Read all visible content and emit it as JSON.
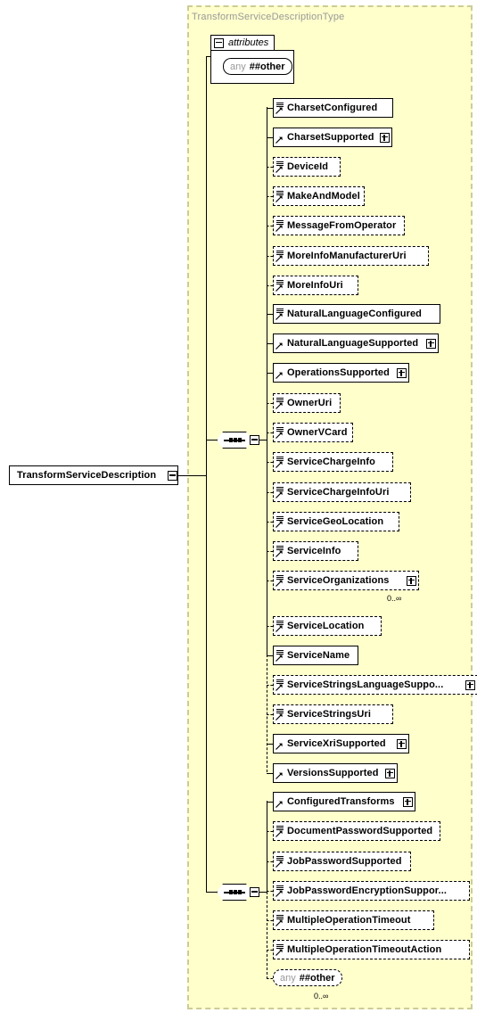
{
  "diagram": {
    "kind": "xml-schema-element-diagram",
    "type_container_label": "TransformServiceDescriptionType",
    "root": {
      "label": "TransformServiceDescription",
      "toggle": "minus"
    },
    "attributes_group": {
      "label": "attributes",
      "toggle": "minus",
      "wildcard": {
        "any": "any",
        "namespace": "##other"
      }
    },
    "sequences": [
      {
        "name": "sequence-1",
        "compositor_icon": "sequence-icon",
        "toggle": "minus",
        "children": [
          {
            "label": "CharsetConfigured",
            "optional": false,
            "icon": true,
            "expand": false,
            "cardinality": ""
          },
          {
            "label": "CharsetSupported",
            "optional": false,
            "icon": false,
            "expand": true,
            "cardinality": ""
          },
          {
            "label": "DeviceId",
            "optional": true,
            "icon": true,
            "expand": false,
            "cardinality": ""
          },
          {
            "label": "MakeAndModel",
            "optional": true,
            "icon": true,
            "expand": false,
            "cardinality": ""
          },
          {
            "label": "MessageFromOperator",
            "optional": true,
            "icon": true,
            "expand": false,
            "cardinality": ""
          },
          {
            "label": "MoreInfoManufacturerUri",
            "optional": true,
            "icon": true,
            "expand": false,
            "cardinality": ""
          },
          {
            "label": "MoreInfoUri",
            "optional": true,
            "icon": true,
            "expand": false,
            "cardinality": ""
          },
          {
            "label": "NaturalLanguageConfigured",
            "optional": false,
            "icon": true,
            "expand": false,
            "cardinality": ""
          },
          {
            "label": "NaturalLanguageSupported",
            "optional": false,
            "icon": false,
            "expand": true,
            "cardinality": ""
          },
          {
            "label": "OperationsSupported",
            "optional": false,
            "icon": false,
            "expand": true,
            "cardinality": ""
          },
          {
            "label": "OwnerUri",
            "optional": true,
            "icon": true,
            "expand": false,
            "cardinality": ""
          },
          {
            "label": "OwnerVCard",
            "optional": true,
            "icon": true,
            "expand": false,
            "cardinality": ""
          },
          {
            "label": "ServiceChargeInfo",
            "optional": true,
            "icon": true,
            "expand": false,
            "cardinality": ""
          },
          {
            "label": "ServiceChargeInfoUri",
            "optional": true,
            "icon": true,
            "expand": false,
            "cardinality": ""
          },
          {
            "label": "ServiceGeoLocation",
            "optional": true,
            "icon": true,
            "expand": false,
            "cardinality": ""
          },
          {
            "label": "ServiceInfo",
            "optional": true,
            "icon": true,
            "expand": false,
            "cardinality": ""
          },
          {
            "label": "ServiceOrganizations",
            "optional": true,
            "icon": true,
            "expand": true,
            "cardinality": "0..∞"
          },
          {
            "label": "ServiceLocation",
            "optional": true,
            "icon": true,
            "expand": false,
            "cardinality": ""
          },
          {
            "label": "ServiceName",
            "optional": false,
            "icon": true,
            "expand": false,
            "cardinality": ""
          },
          {
            "label": "ServiceStringsLanguageSuppo...",
            "optional": true,
            "icon": true,
            "expand": true,
            "cardinality": ""
          },
          {
            "label": "ServiceStringsUri",
            "optional": true,
            "icon": true,
            "expand": false,
            "cardinality": ""
          },
          {
            "label": "ServiceXriSupported",
            "optional": false,
            "icon": false,
            "expand": true,
            "cardinality": ""
          },
          {
            "label": "VersionsSupported",
            "optional": false,
            "icon": false,
            "expand": true,
            "cardinality": ""
          }
        ]
      },
      {
        "name": "sequence-2",
        "compositor_icon": "sequence-icon",
        "toggle": "minus",
        "children": [
          {
            "label": "ConfiguredTransforms",
            "optional": false,
            "icon": false,
            "expand": true,
            "cardinality": ""
          },
          {
            "label": "DocumentPasswordSupported",
            "optional": true,
            "icon": true,
            "expand": false,
            "cardinality": ""
          },
          {
            "label": "JobPasswordSupported",
            "optional": true,
            "icon": true,
            "expand": false,
            "cardinality": ""
          },
          {
            "label": "JobPasswordEncryptionSuppor...",
            "optional": true,
            "icon": true,
            "expand": false,
            "cardinality": ""
          },
          {
            "label": "MultipleOperationTimeout",
            "optional": true,
            "icon": true,
            "expand": false,
            "cardinality": ""
          },
          {
            "label": "MultipleOperationTimeoutAction",
            "optional": true,
            "icon": true,
            "expand": false,
            "cardinality": ""
          }
        ],
        "wildcard": {
          "any": "any",
          "namespace": "##other",
          "cardinality": "0..∞"
        }
      }
    ],
    "colors": {
      "type_fill": "#ffffcc",
      "type_border": "#cccc99",
      "type_label": "#999999",
      "node_fill": "#ffffff",
      "node_border": "#000000",
      "shadow": "#c0c0c0",
      "any_label": "#999999"
    }
  }
}
